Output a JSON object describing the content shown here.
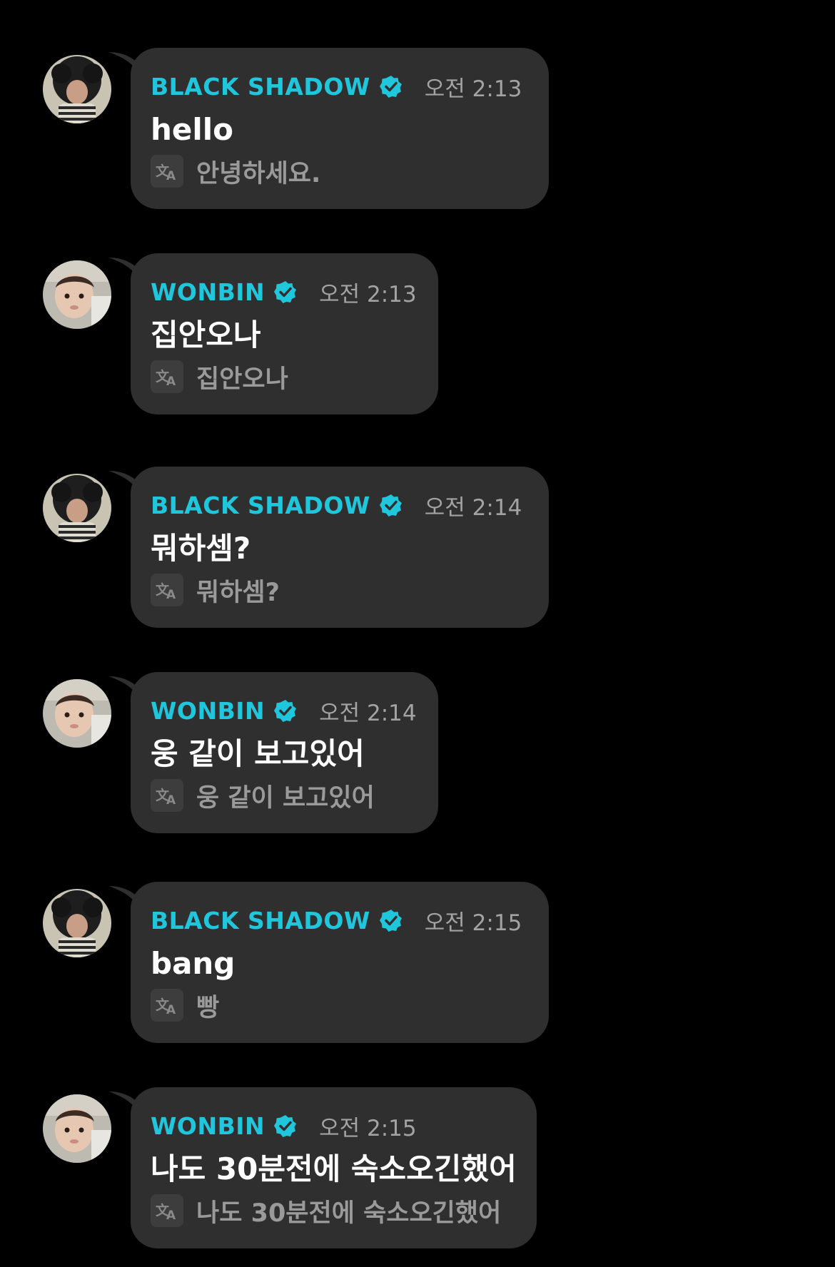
{
  "messages": [
    {
      "sender": "BLACK SHADOW",
      "avatar": "black-shadow",
      "time": "오전 2:13",
      "text": "hello",
      "translation": "안녕하세요."
    },
    {
      "sender": "WONBIN",
      "avatar": "wonbin",
      "time": "오전 2:13",
      "text": "집안오나",
      "translation": "집안오나"
    },
    {
      "sender": "BLACK SHADOW",
      "avatar": "black-shadow",
      "time": "오전 2:14",
      "text": "뭐하셈?",
      "translation": "뭐하셈?"
    },
    {
      "sender": "WONBIN",
      "avatar": "wonbin",
      "time": "오전 2:14",
      "text": "웅 같이 보고있어",
      "translation": "웅 같이 보고있어"
    },
    {
      "sender": "BLACK SHADOW",
      "avatar": "black-shadow",
      "time": "오전 2:15",
      "text": "bang",
      "translation": "빵"
    },
    {
      "sender": "WONBIN",
      "avatar": "wonbin",
      "time": "오전 2:15",
      "text": "나도 30분전에 숙소오긴했어",
      "translation": "나도 30분전에 숙소오긴했어"
    }
  ],
  "colors": {
    "background": "#000000",
    "bubble": "#2f2f2f",
    "name": "#20c7dc",
    "verified": "#20c7dc",
    "time": "#a3a3a3",
    "text": "#ffffff",
    "translation": "#9a9a9a"
  },
  "icons": {
    "verified": "verified-badge-icon",
    "translate": "translate-icon"
  }
}
